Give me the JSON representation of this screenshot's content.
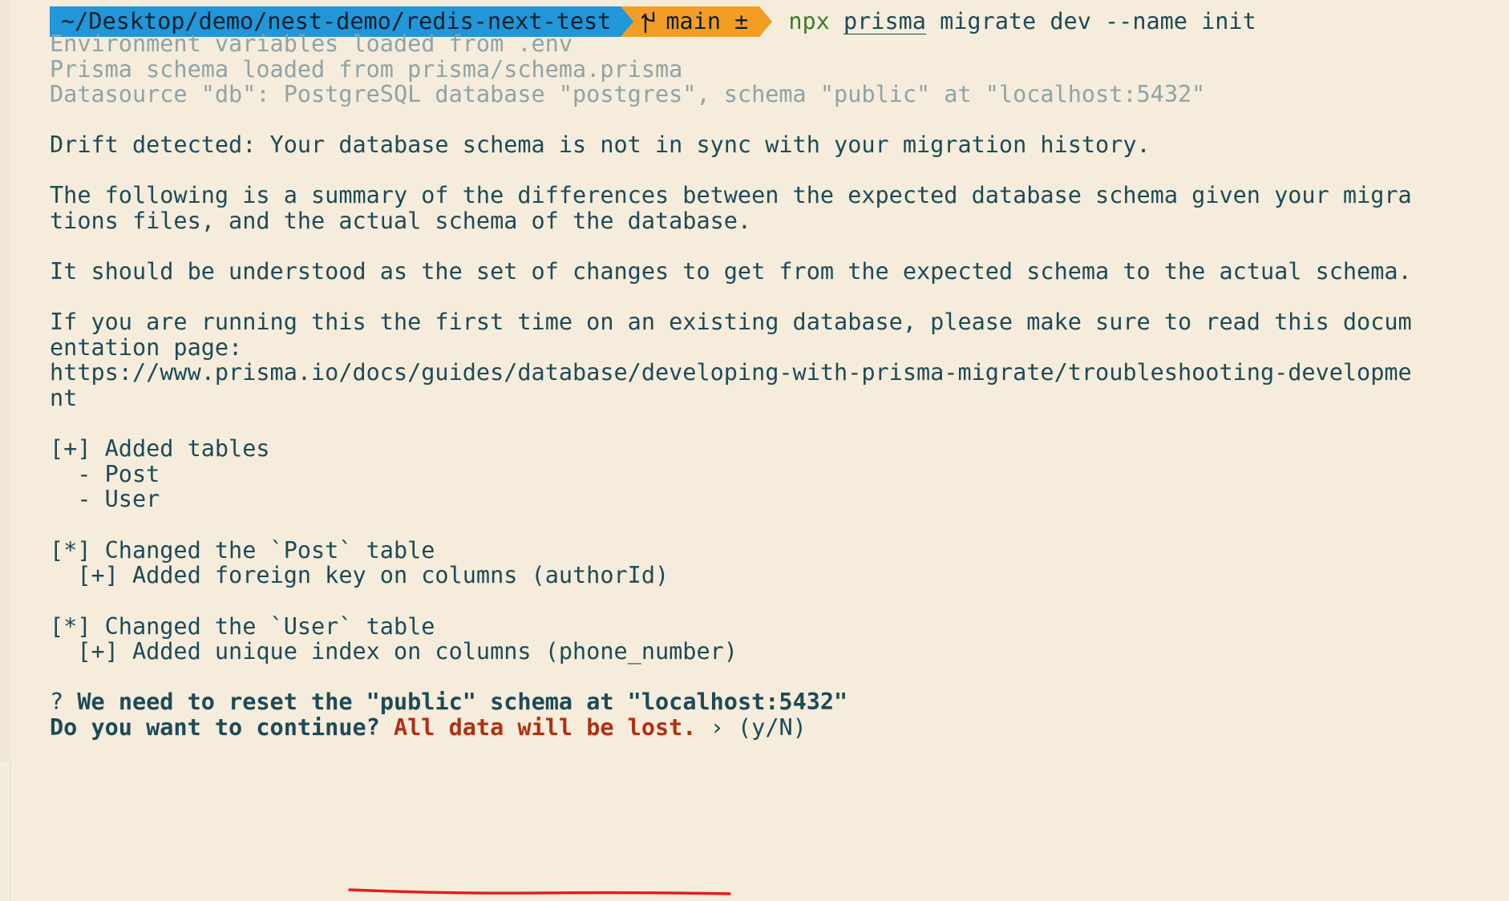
{
  "prompt": {
    "directory": "~/Desktop/demo/nest-demo/redis-next-test",
    "branch": "main",
    "dirty_marker": "±",
    "command_bin": "npx",
    "command_tool": "prisma",
    "command_args": "migrate dev --name init"
  },
  "output": {
    "env_loaded": "Environment variables loaded from .env",
    "schema_loaded": "Prisma schema loaded from prisma/schema.prisma",
    "datasource": "Datasource \"db\": PostgreSQL database \"postgres\", schema \"public\" at \"localhost:5432\"",
    "drift": "Drift detected: Your database schema is not in sync with your migration history.",
    "summary_1": "The following is a summary of the differences between the expected database schema given your migra",
    "summary_2": "tions files, and the actual schema of the database.",
    "understood": "It should be understood as the set of changes to get from the expected schema to the actual schema.",
    "first_time_1": "If you are running this the first time on an existing database, please make sure to read this docum",
    "first_time_2": "entation page:",
    "url_1": "https://www.prisma.io/docs/guides/database/developing-with-prisma-migrate/troubleshooting-developme",
    "url_2": "nt",
    "added_tables_header": "[+] Added tables",
    "added_table_1": "  - Post",
    "added_table_2": "  - User",
    "changed_post_header": "[*] Changed the `Post` table",
    "changed_post_detail": "  [+] Added foreign key on columns (authorId)",
    "changed_user_header": "[*] Changed the `User` table",
    "changed_user_detail": "  [+] Added unique index on columns (phone_number)"
  },
  "question": {
    "mark": "?",
    "reset_text": "We need to reset the \"public\" schema at \"localhost:5432\"",
    "continue_text": "Do you want to continue?",
    "warning_text": "All data will be lost.",
    "chevron": "›",
    "choice": "(y/N)"
  },
  "colors": {
    "background": "#f5ecdc",
    "text": "#1d4a56",
    "dim_text": "#8fa3a6",
    "prompt_dir_bg": "#2196d8",
    "prompt_git_bg": "#f29d24",
    "command_green": "#3a7d2a",
    "warning_red": "#b03011",
    "annotation_red": "#e02020"
  }
}
